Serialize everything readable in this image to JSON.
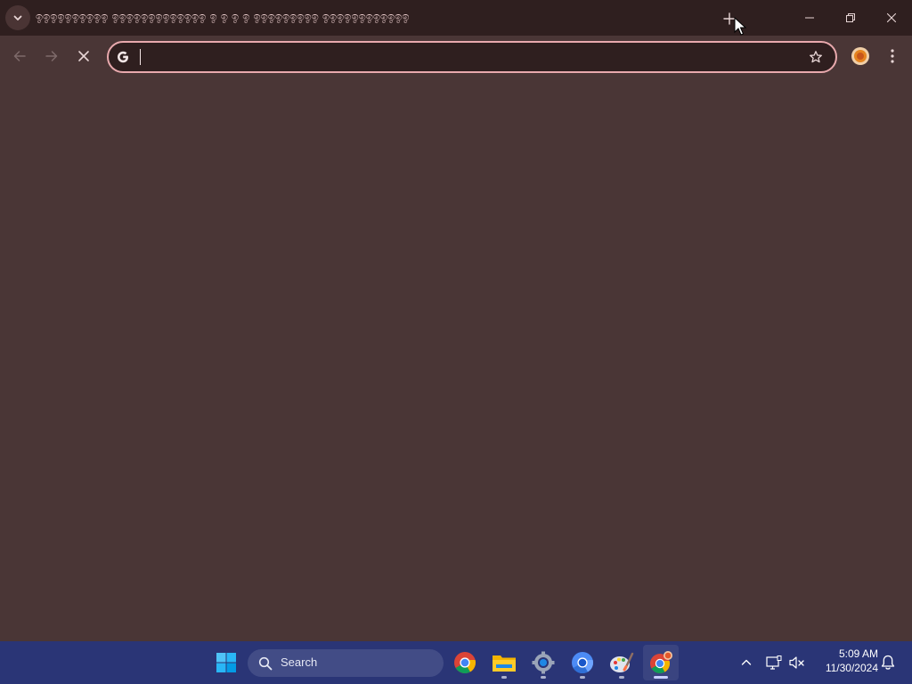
{
  "colors": {
    "tabstrip_bg": "#2f1f1f",
    "toolbar_bg": "#4a3636",
    "omnibox_border": "#e8a9ad",
    "omnibox_bg": "#2f1f1f",
    "taskbar_bg": "#2a3576",
    "icon_fg": "#e8d6d6"
  },
  "browser": {
    "tab_strip_text": "ඉඉඉඉඉඉඉඉඉඉ ඉඉඉඉඉඉඉඉඉඉඉඉඉ ඉ ඉ ඉ ඉ ඉඉඉඉඉඉඉඉඉ ඉඉඉඉඉඉඉඉඉඉඉඉ",
    "icons": {
      "tab_search": "chevron-down-icon",
      "new_tab": "plus-icon",
      "minimize": "minimize-icon",
      "restore": "restore-icon",
      "close": "close-icon",
      "back": "arrow-left-icon",
      "forward": "arrow-right-icon",
      "stop": "stop-icon",
      "google": "google-g-icon",
      "bookmark": "star-icon",
      "profile": "profile-avatar-icon",
      "menu": "more-vertical-icon"
    },
    "omnibox": {
      "value": "",
      "placeholder": ""
    }
  },
  "taskbar": {
    "search_label": "Search",
    "apps": [
      {
        "name": "Google Chrome",
        "icon": "chrome-icon",
        "running": false
      },
      {
        "name": "File Explorer",
        "icon": "folder-icon",
        "running": true
      },
      {
        "name": "Settings",
        "icon": "settings-gear-icon",
        "running": true
      },
      {
        "name": "Chromium",
        "icon": "chromium-icon",
        "running": true
      },
      {
        "name": "Paint",
        "icon": "paint-icon",
        "running": true
      },
      {
        "name": "Google Chrome (active)",
        "icon": "chrome-icon",
        "running": true,
        "active": true
      }
    ],
    "tray": {
      "time": "5:09 AM",
      "date": "11/30/2024"
    }
  }
}
